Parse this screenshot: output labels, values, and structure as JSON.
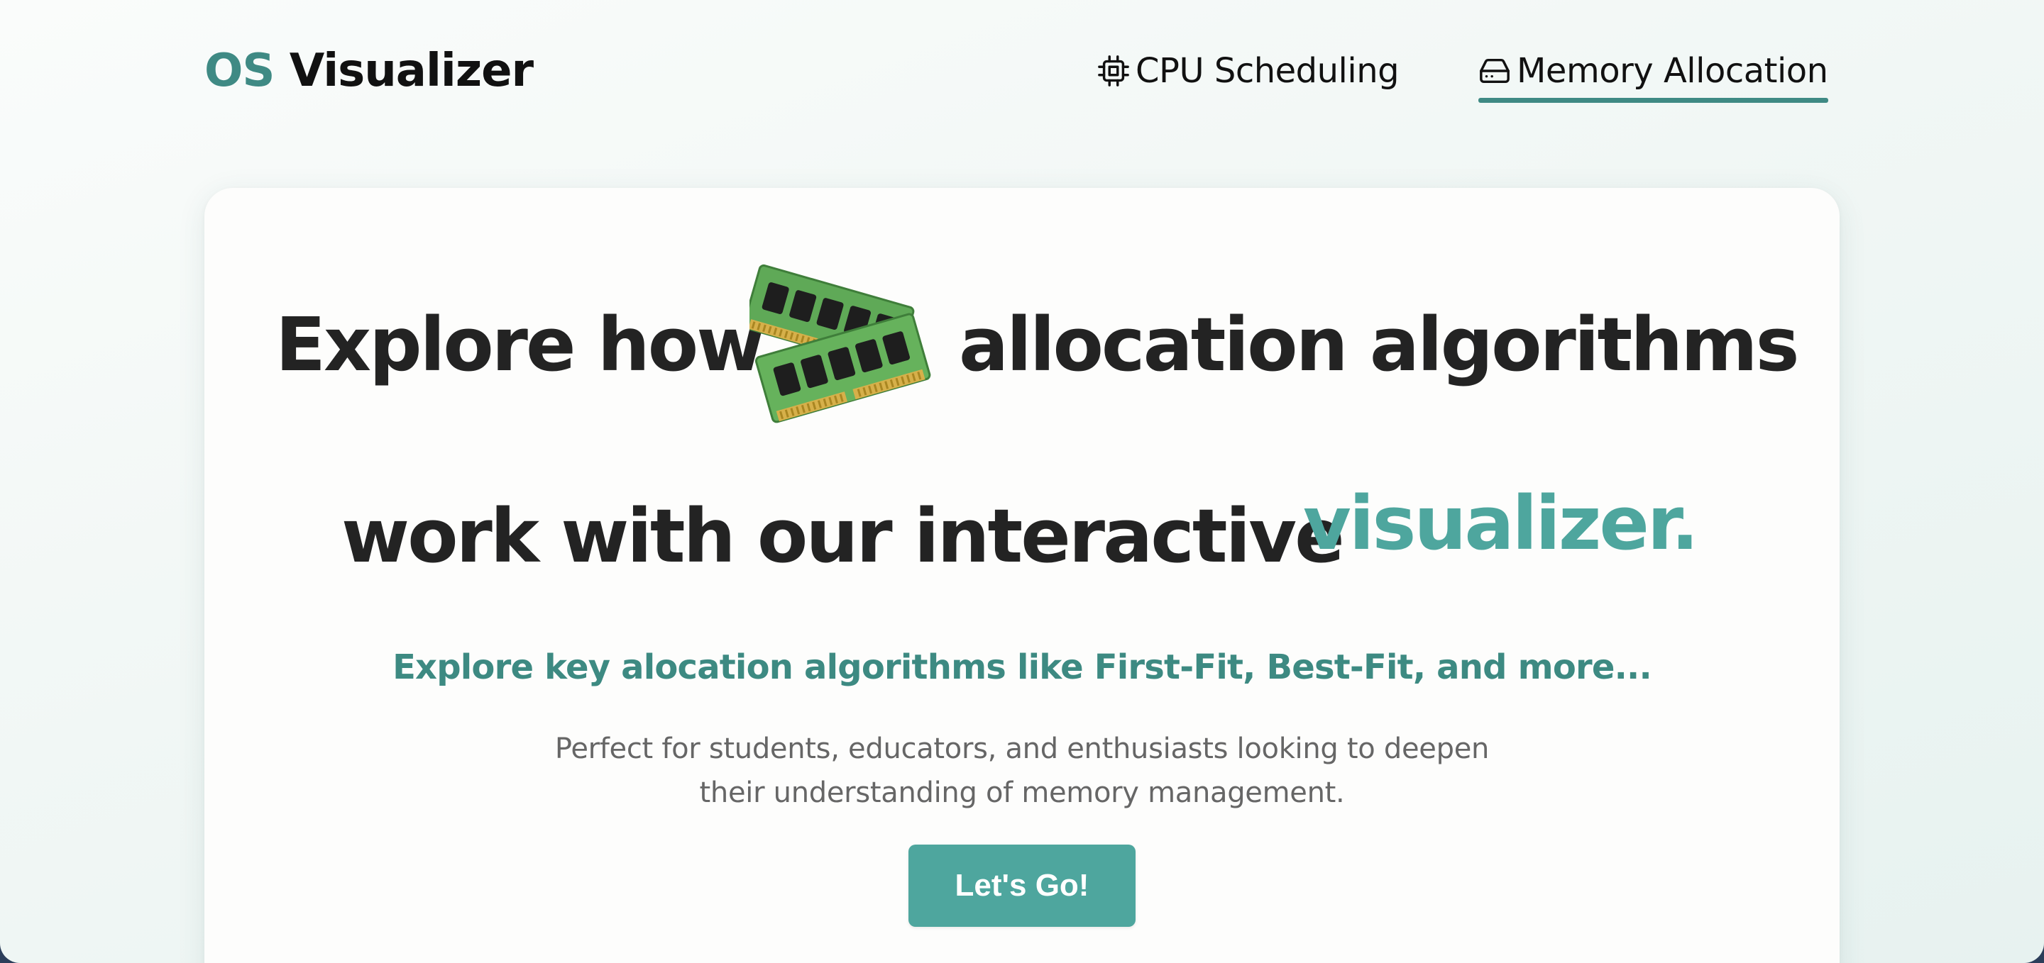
{
  "brand": {
    "prefix": "OS",
    "suffix": "Visualizer"
  },
  "nav": {
    "items": [
      {
        "label": "CPU Scheduling",
        "icon": "cpu-chip-icon",
        "active": false
      },
      {
        "label": "Memory Allocation",
        "icon": "hard-drive-icon",
        "active": true
      }
    ]
  },
  "hero": {
    "headline": {
      "line1_before": "Explore how",
      "line1_after": "allocation algorithms",
      "line2": "work with our interactive",
      "highlight": "visualizer."
    },
    "image_icon": "ram-modules-icon",
    "subtitle": "Explore key alocation algorithms like First-Fit, Best-Fit, and more...",
    "description": {
      "line1": "Perfect for students, educators, and enthusiasts looking to deepen",
      "line2": "their understanding of memory management."
    },
    "cta_label": "Let's Go!"
  },
  "colors": {
    "accent": "#3f8a84",
    "highlight": "#4ea69e",
    "heading": "#232323",
    "body_text": "#666666"
  }
}
